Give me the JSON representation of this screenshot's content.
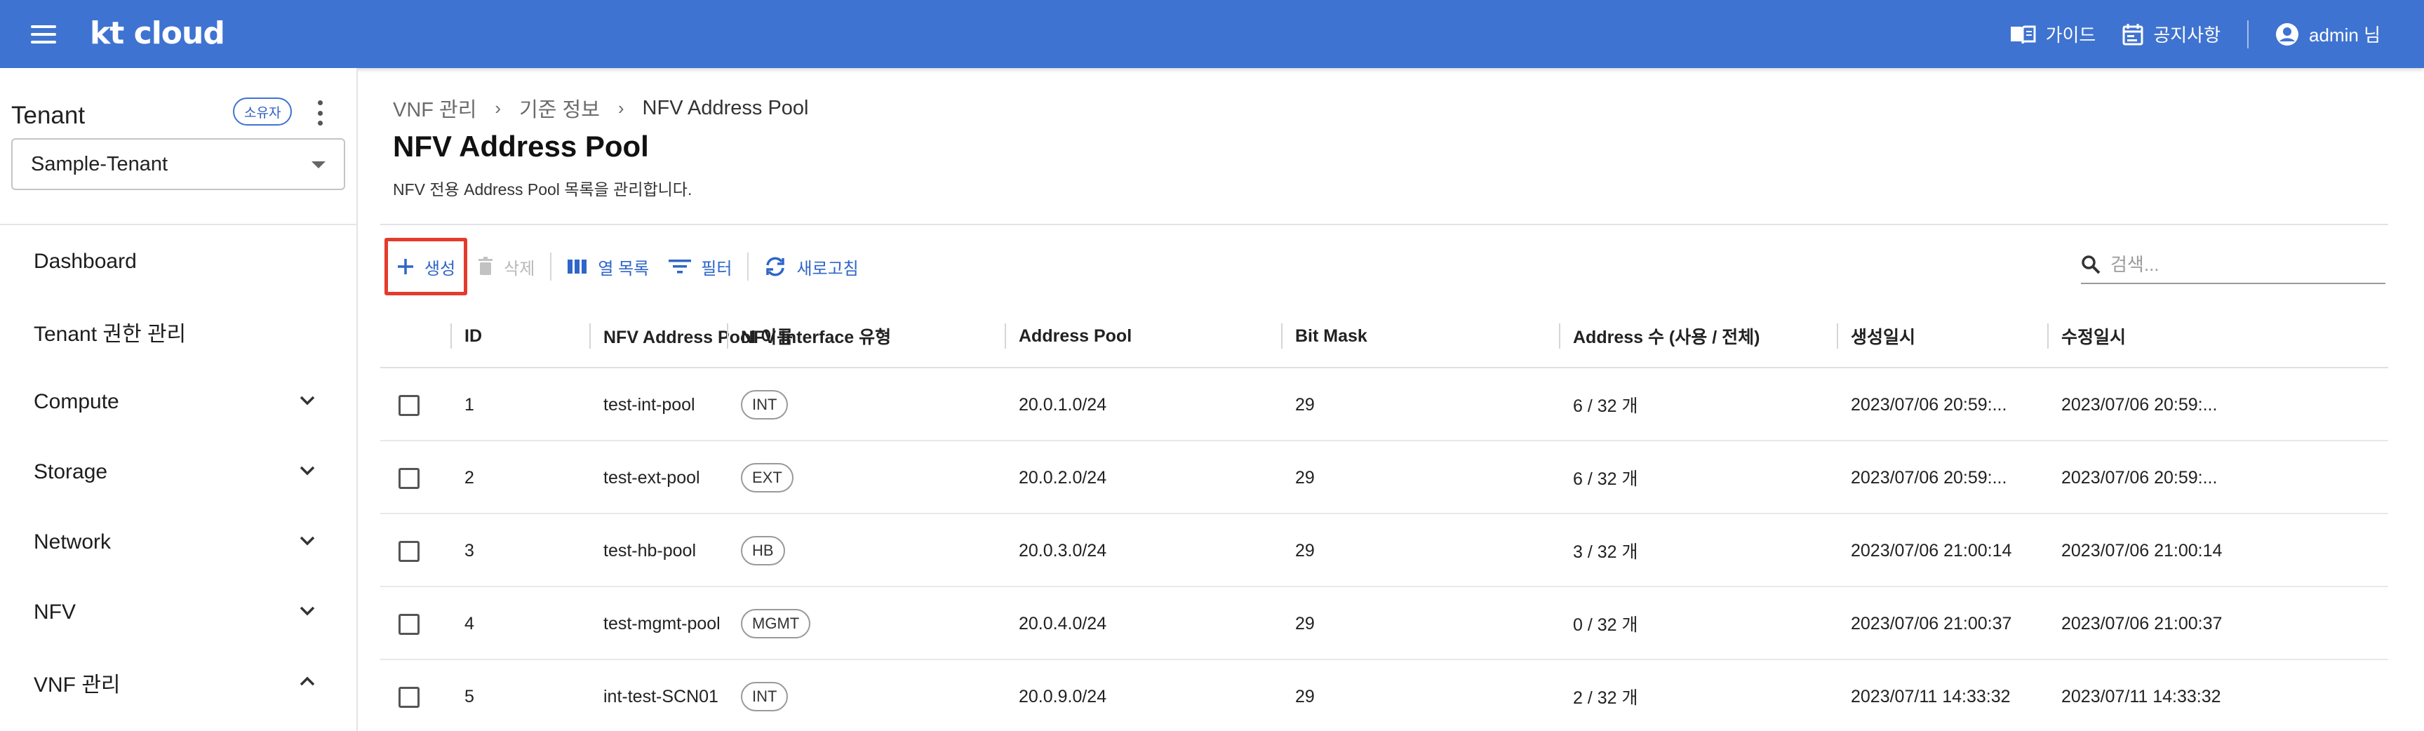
{
  "topbar": {
    "logo": "kt cloud",
    "guide_label": "가이드",
    "notice_label": "공지사항",
    "user_label": "admin 님"
  },
  "sidebar": {
    "tenant_title": "Tenant",
    "owner_badge": "소유자",
    "tenant_selected": "Sample-Tenant",
    "items": [
      {
        "label": "Dashboard"
      },
      {
        "label": "Tenant 권한 관리"
      },
      {
        "label": "Compute"
      },
      {
        "label": "Storage"
      },
      {
        "label": "Network"
      },
      {
        "label": "NFV"
      },
      {
        "label": "VNF 관리"
      }
    ]
  },
  "breadcrumb": {
    "items": [
      "VNF 관리",
      "기준 정보",
      "NFV Address Pool"
    ]
  },
  "page": {
    "title": "NFV Address Pool",
    "description": "NFV 전용 Address Pool 목록을 관리합니다."
  },
  "toolbar": {
    "create_label": "생성",
    "delete_label": "삭제",
    "columns_label": "열 목록",
    "filter_label": "필터",
    "refresh_label": "새로고침"
  },
  "search": {
    "placeholder": "검색..."
  },
  "table": {
    "headers": {
      "id": "ID",
      "name": "NFV Address Pool 이름",
      "type": "NFV Interface 유형",
      "pool": "Address Pool",
      "mask": "Bit Mask",
      "count": "Address 수 (사용 / 전체)",
      "created": "생성일시",
      "updated": "수정일시"
    },
    "rows": [
      {
        "id": "1",
        "name": "test-int-pool",
        "type": "INT",
        "pool": "20.0.1.0/24",
        "mask": "29",
        "count": "6 / 32 개",
        "created": "2023/07/06 20:59:...",
        "updated": "2023/07/06 20:59:..."
      },
      {
        "id": "2",
        "name": "test-ext-pool",
        "type": "EXT",
        "pool": "20.0.2.0/24",
        "mask": "29",
        "count": "6 / 32 개",
        "created": "2023/07/06 20:59:...",
        "updated": "2023/07/06 20:59:..."
      },
      {
        "id": "3",
        "name": "test-hb-pool",
        "type": "HB",
        "pool": "20.0.3.0/24",
        "mask": "29",
        "count": "3 / 32 개",
        "created": "2023/07/06 21:00:14",
        "updated": "2023/07/06 21:00:14"
      },
      {
        "id": "4",
        "name": "test-mgmt-pool",
        "type": "MGMT",
        "pool": "20.0.4.0/24",
        "mask": "29",
        "count": "0 / 32 개",
        "created": "2023/07/06 21:00:37",
        "updated": "2023/07/06 21:00:37"
      },
      {
        "id": "5",
        "name": "int-test-SCN01",
        "type": "INT",
        "pool": "20.0.9.0/24",
        "mask": "29",
        "count": "2 / 32 개",
        "created": "2023/07/11 14:33:32",
        "updated": "2023/07/11 14:33:32"
      }
    ]
  },
  "colors": {
    "topbar": "#3f73d1",
    "accent": "#2f66c8",
    "highlight_border": "#e53b2c"
  }
}
